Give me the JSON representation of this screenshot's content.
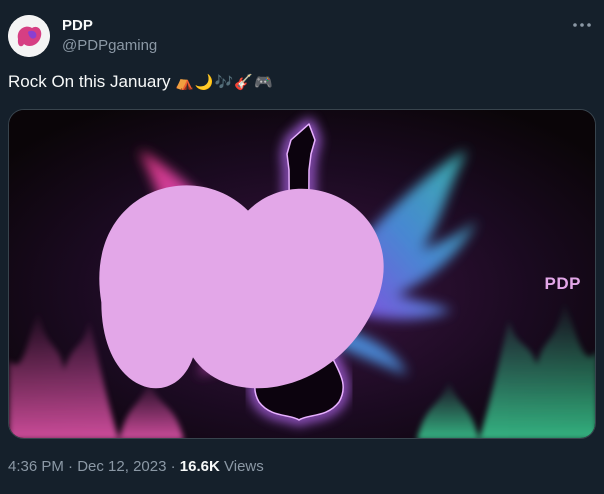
{
  "author": {
    "name": "PDP",
    "handle": "@PDPgaming"
  },
  "tweet": {
    "text": "Rock On this January",
    "emoji": "⛺🌙🎶🎸🎮"
  },
  "media": {
    "brand_text": "PDP",
    "icons": [
      "guitar-silhouette",
      "wings",
      "flames"
    ],
    "colors": {
      "glow": "#c070ff",
      "wing_left": "#ff4fa3",
      "wing_right": "#3fd1c2",
      "brand": "#e3a7e8"
    }
  },
  "meta": {
    "time": "4:36 PM",
    "sep1": "·",
    "date": "Dec 12, 2023",
    "sep2": "·",
    "views_count": "16.6K",
    "views_label": "Views"
  },
  "theme": {
    "background": "#15202b",
    "text": "#f7f9f9",
    "muted": "#8b98a5"
  }
}
